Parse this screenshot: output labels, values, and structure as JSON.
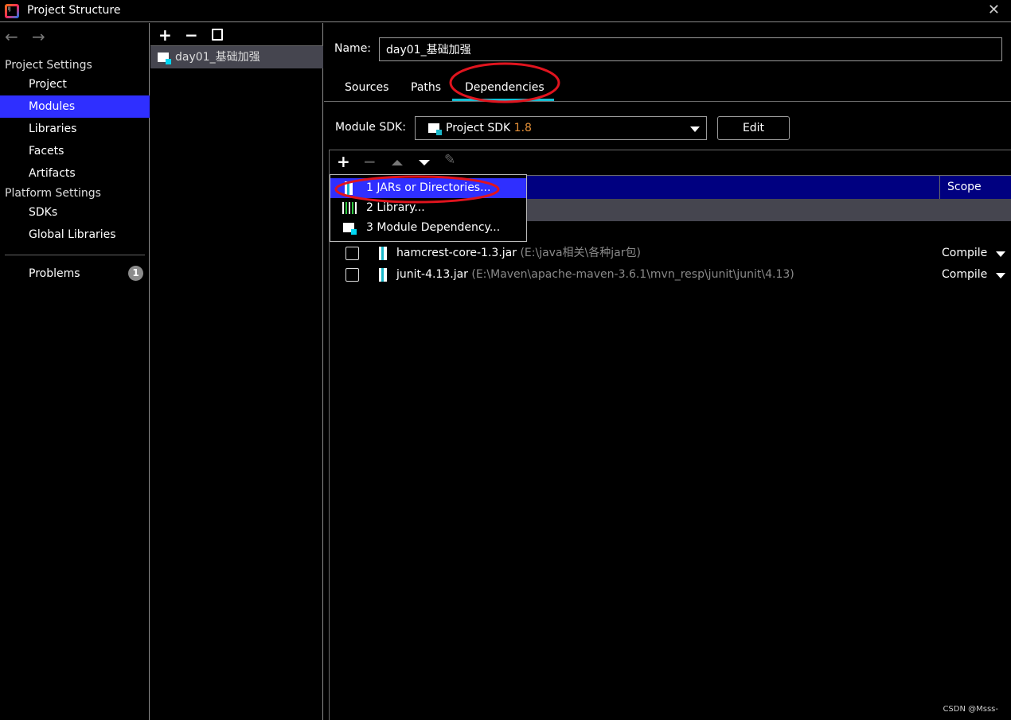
{
  "window": {
    "title": "Project Structure",
    "close_icon": "close-icon"
  },
  "sidebar": {
    "project_settings": "Project Settings",
    "items": [
      {
        "label": "Project"
      },
      {
        "label": "Modules",
        "selected": true
      },
      {
        "label": "Libraries"
      },
      {
        "label": "Facets"
      },
      {
        "label": "Artifacts"
      }
    ],
    "platform_settings": "Platform Settings",
    "platform_items": [
      {
        "label": "SDKs"
      },
      {
        "label": "Global Libraries"
      }
    ],
    "problems": {
      "label": "Problems",
      "count": "1"
    }
  },
  "modules": {
    "items": [
      {
        "label": "day01_基础加强"
      }
    ]
  },
  "main": {
    "name_label": "Name:",
    "name_value": "day01_基础加强",
    "tabs": [
      {
        "label": "Sources"
      },
      {
        "label": "Paths"
      },
      {
        "label": "Dependencies",
        "active": true
      }
    ],
    "sdk_label": "Module SDK:",
    "sdk_value": "Project SDK",
    "sdk_version": "1.8",
    "edit_label": "Edit",
    "table": {
      "scope_header": "Scope",
      "rows": [
        {
          "name": "hamcrest-core-1.3.jar",
          "path": "(E:\\java相关\\各种jar包)",
          "scope": "Compile"
        },
        {
          "name": "junit-4.13.jar",
          "path": "(E:\\Maven\\apache-maven-3.6.1\\mvn_resp\\junit\\junit\\4.13)",
          "scope": "Compile"
        }
      ]
    },
    "popup": [
      {
        "label": "1  JARs or Directories..."
      },
      {
        "label": "2  Library..."
      },
      {
        "label": "3  Module Dependency..."
      }
    ]
  },
  "colors": {
    "selection": "#2f2fff",
    "header": "#000080",
    "accent": "#14c0d5",
    "annotation": "#e0141e"
  },
  "watermark": "CSDN @Msss-"
}
